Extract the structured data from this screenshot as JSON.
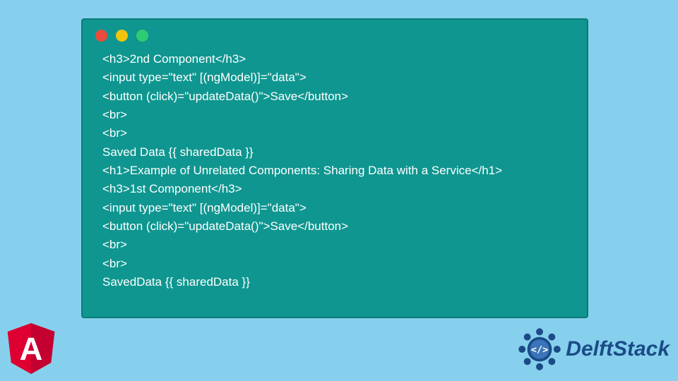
{
  "code_lines": [
    "<h3>2nd Component</h3>",
    "<input type=\"text\" [(ngModel)]=\"data\">",
    "<button (click)=\"updateData()\">Save</button>",
    "<br>",
    "<br>",
    "Saved Data {{ sharedData }}",
    "<h1>Example of Unrelated Components: Sharing Data with a Service</h1>",
    "<h3>1st Component</h3>",
    "<input type=\"text\" [(ngModel)]=\"data\">",
    "<button (click)=\"updateData()\">Save</button>",
    "<br>",
    "<br>",
    "SavedData {{ sharedData }}"
  ],
  "brand": {
    "name": "DelftStack",
    "angular_letter": "A"
  }
}
